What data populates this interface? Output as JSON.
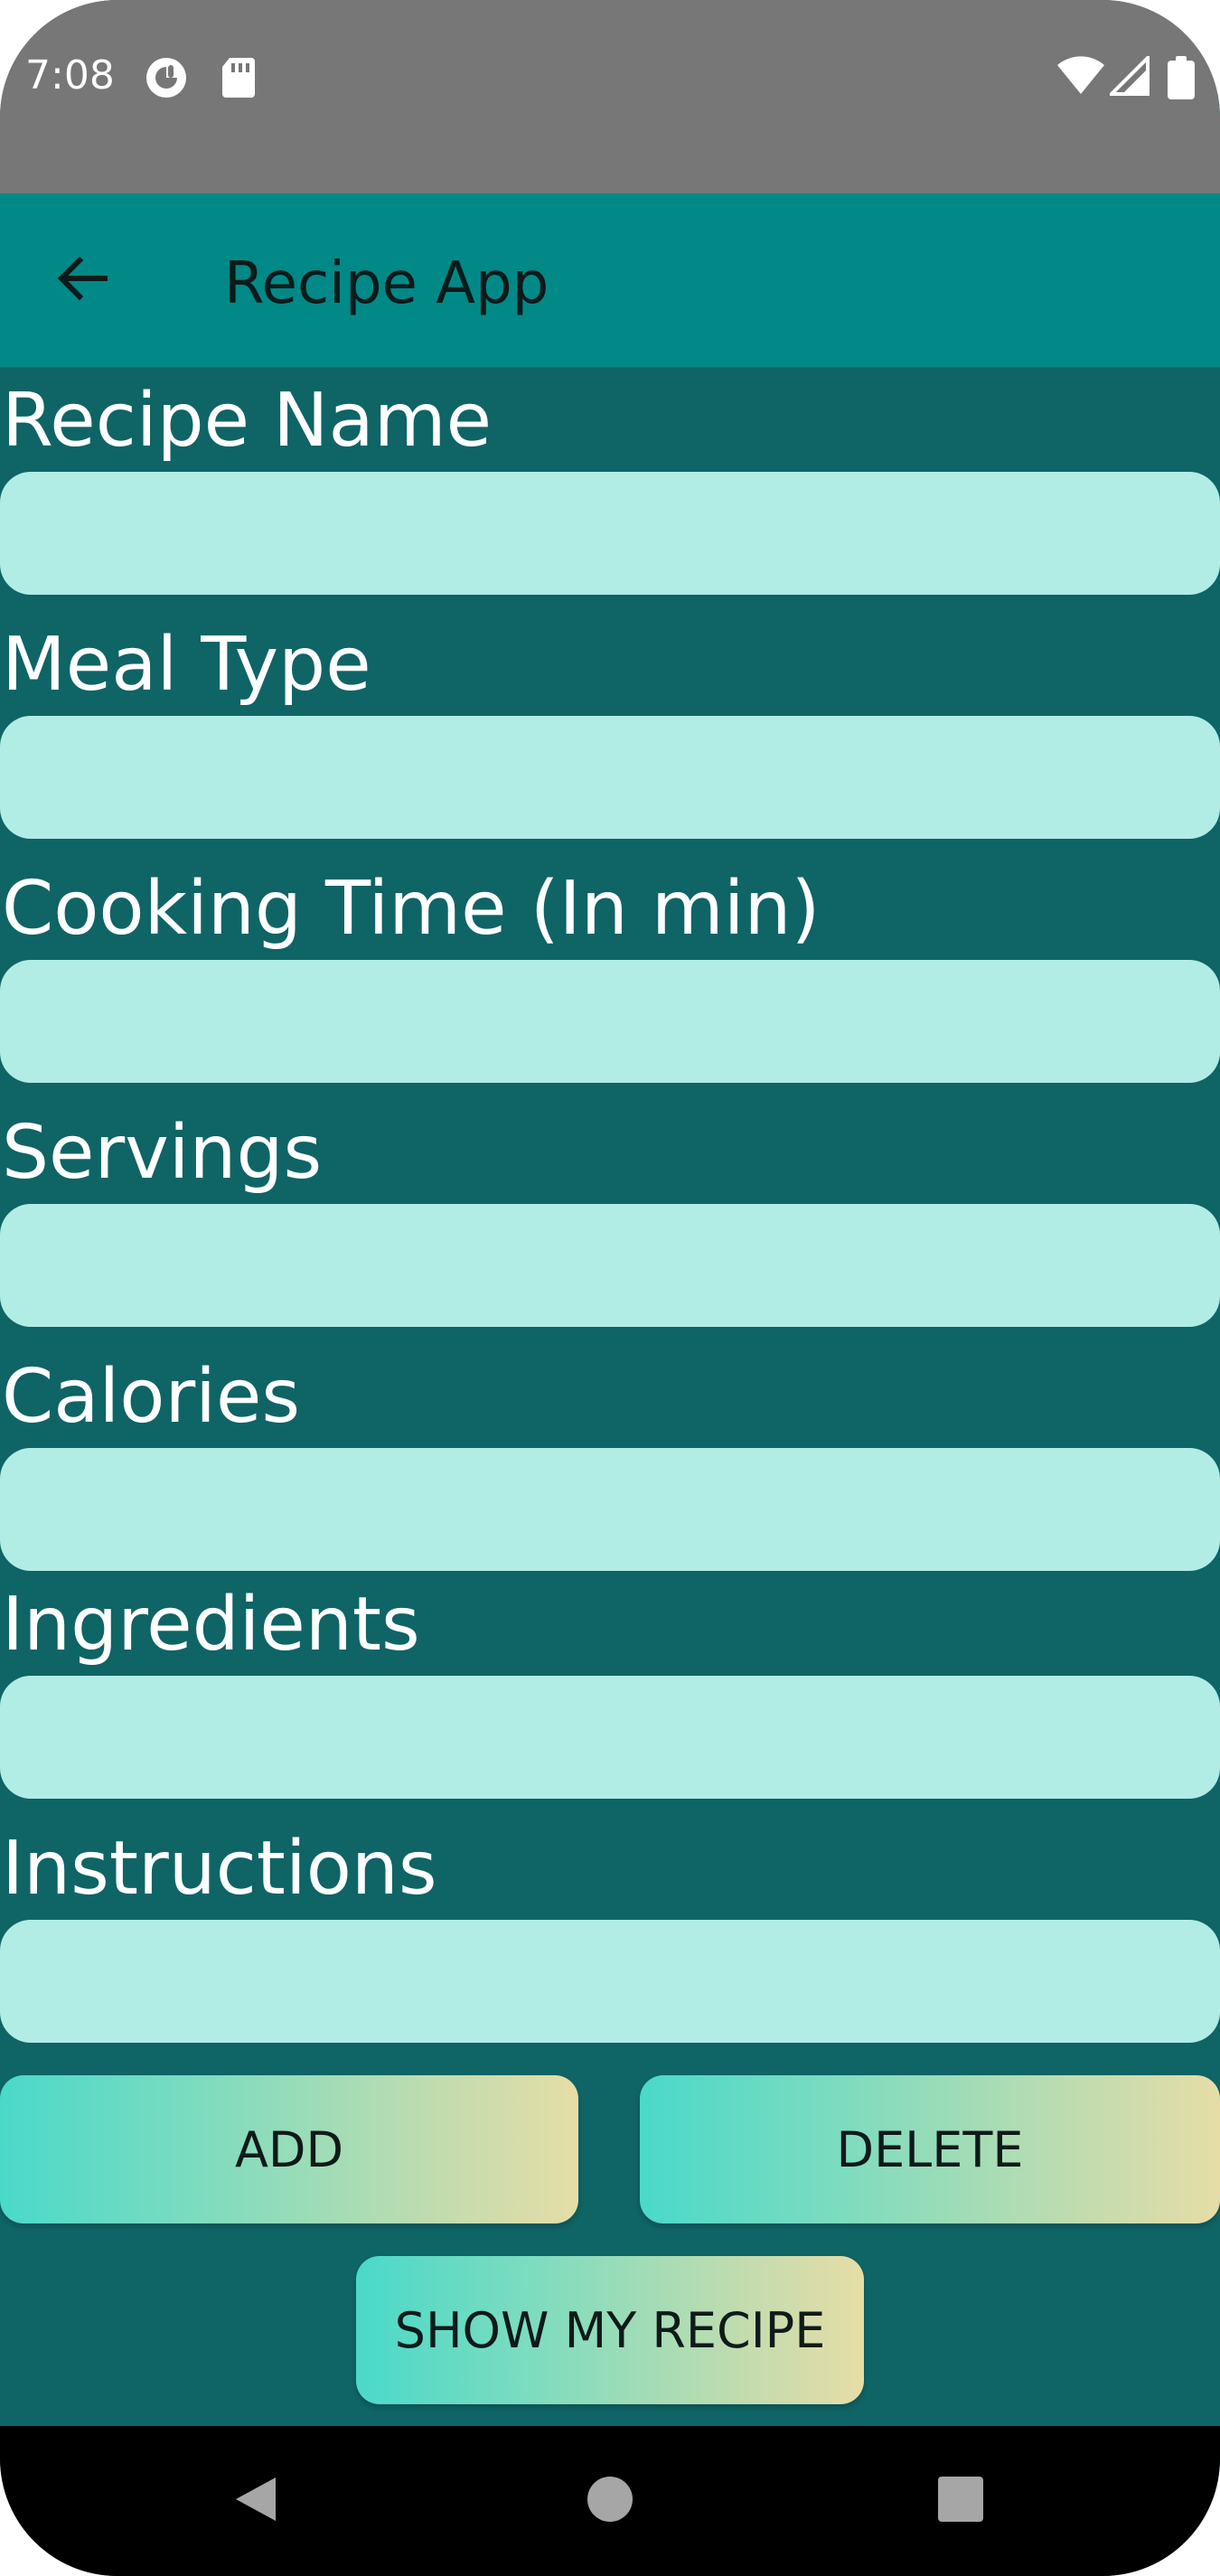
{
  "status_bar": {
    "time": "7:08",
    "icons": [
      "circle-app-icon",
      "sd-card-icon",
      "wifi-icon",
      "signal-icon",
      "battery-icon"
    ]
  },
  "app_bar": {
    "back_icon": "arrow-back-icon",
    "title": "Recipe App",
    "color": "#008987"
  },
  "form": {
    "background": "#0f6466",
    "input_color": "#b1ede4",
    "fields": [
      {
        "label": "Recipe Name",
        "value": "",
        "placeholder": ""
      },
      {
        "label": "Meal Type",
        "value": "",
        "placeholder": ""
      },
      {
        "label": "Cooking Time (In min)",
        "value": "",
        "placeholder": ""
      },
      {
        "label": "Servings",
        "value": "",
        "placeholder": ""
      },
      {
        "label": "Calories",
        "value": "",
        "placeholder": ""
      },
      {
        "label": "Ingredients",
        "value": "",
        "placeholder": ""
      },
      {
        "label": "Instructions",
        "value": "",
        "placeholder": ""
      }
    ]
  },
  "buttons": {
    "add_label": "ADD",
    "delete_label": "DELETE",
    "show_label": "SHOW MY RECIPE",
    "gradient_start": "#4ad9c9",
    "gradient_end": "#e6dda6"
  },
  "nav_bar": {
    "icons": [
      "back-triangle-icon",
      "home-circle-icon",
      "recents-square-icon"
    ]
  }
}
